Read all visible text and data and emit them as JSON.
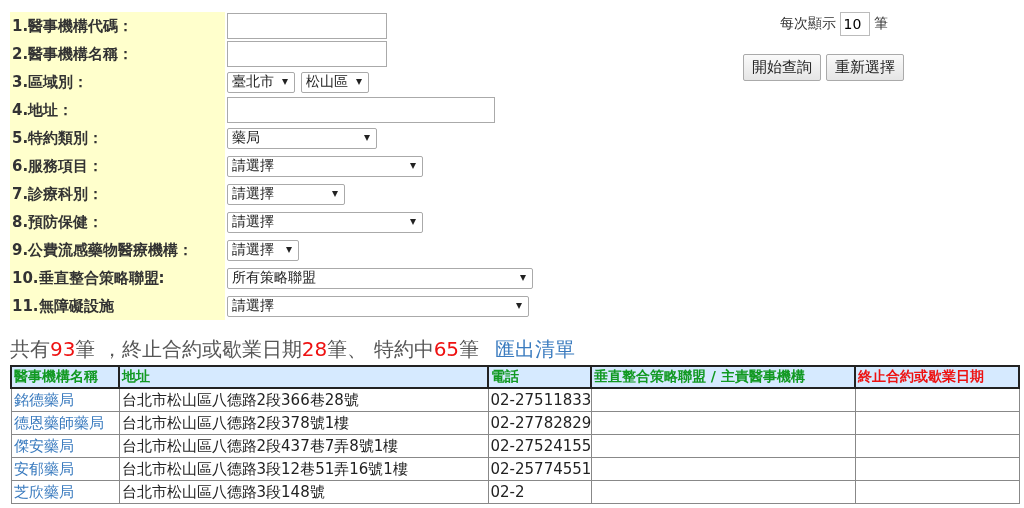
{
  "form": {
    "fields": [
      {
        "label": "1.醫事機構代碼：",
        "kind": "text"
      },
      {
        "label": "2.醫事機構名稱：",
        "kind": "text"
      },
      {
        "label": "3.區域別：",
        "kind": "select-pair",
        "values": [
          "臺北市",
          "松山區"
        ]
      },
      {
        "label": "4.地址：",
        "kind": "text"
      },
      {
        "label": "5.特約類別：",
        "kind": "select",
        "value": "藥局"
      },
      {
        "label": "6.服務項目：",
        "kind": "select",
        "value": "請選擇"
      },
      {
        "label": "7.診療科別：",
        "kind": "select",
        "value": "請選擇"
      },
      {
        "label": "8.預防保健：",
        "kind": "select",
        "value": "請選擇"
      },
      {
        "label": "9.公費流感藥物醫療機構：",
        "kind": "select",
        "value": "請選擇"
      },
      {
        "label": "10.垂直整合策略聯盟:",
        "kind": "select",
        "value": "所有策略聯盟"
      },
      {
        "label": "11.無障礙設施",
        "kind": "select",
        "value": "請選擇"
      }
    ]
  },
  "page_size": {
    "label": "每次顯示",
    "value": "10",
    "unit": "筆"
  },
  "buttons": [
    "開始查詢",
    "重新選擇"
  ],
  "summary": {
    "parts": [
      {
        "text": "共有",
        "highlight": false
      },
      {
        "text": "93",
        "highlight": true
      },
      {
        "text": "筆 ，終止合約或歇業日期",
        "highlight": false
      },
      {
        "text": "28",
        "highlight": true
      },
      {
        "text": "筆、 特約中",
        "highlight": false
      },
      {
        "text": "65",
        "highlight": true
      },
      {
        "text": "筆",
        "highlight": false
      }
    ],
    "export_link": "匯出清單"
  },
  "table": {
    "columns": [
      {
        "label": "醫事機構名稱",
        "kind": "normal"
      },
      {
        "label": "地址",
        "kind": "normal"
      },
      {
        "label": "電話",
        "kind": "normal"
      },
      {
        "label": "垂直整合策略聯盟 / 主責醫事機構",
        "kind": "normal"
      },
      {
        "label": "終止合約或歇業日期",
        "kind": "alert"
      }
    ],
    "rows": [
      {
        "name": "銘德藥局",
        "address": "台北市松山區八德路2段366巷28號",
        "phone": "02-27511833"
      },
      {
        "name": "德恩藥師藥局",
        "address": "台北市松山區八德路2段378號1樓",
        "phone": "02-27782829"
      },
      {
        "name": "傑安藥局",
        "address": "台北市松山區八德路2段437巷7弄8號1樓",
        "phone": "02-27524155"
      },
      {
        "name": "安郁藥局",
        "address": "台北市松山區八德路3段12巷51弄16號1樓",
        "phone": "02-25774551"
      },
      {
        "name": "芝欣藥局",
        "address": "台北市松山區八德路3段148號",
        "phone": "02-2"
      }
    ]
  }
}
